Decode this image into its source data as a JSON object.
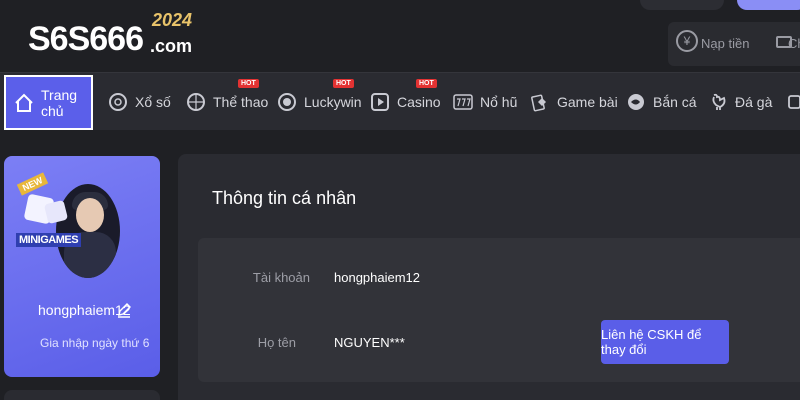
{
  "header": {
    "logo_main": "S6S666",
    "logo_domain": ".com",
    "logo_year": "2024",
    "deposit_label": "Nạp tiền",
    "transfer_label": "Chuyển"
  },
  "nav": {
    "items": [
      {
        "label": "Trang chủ",
        "icon": "home-icon",
        "active": true,
        "hot": false
      },
      {
        "label": "Xổ số",
        "icon": "lottery-ball-icon",
        "active": false,
        "hot": false
      },
      {
        "label": "Thể thao",
        "icon": "sports-ball-icon",
        "active": false,
        "hot": true
      },
      {
        "label": "Luckywin",
        "icon": "poker-chip-icon",
        "active": false,
        "hot": true
      },
      {
        "label": "Casino",
        "icon": "play-icon",
        "active": false,
        "hot": true
      },
      {
        "label": "Nổ hũ",
        "icon": "slot-777-icon",
        "active": false,
        "hot": false
      },
      {
        "label": "Game bài",
        "icon": "cards-icon",
        "active": false,
        "hot": false
      },
      {
        "label": "Bắn cá",
        "icon": "fish-icon",
        "active": false,
        "hot": false
      },
      {
        "label": "Đá gà",
        "icon": "rooster-icon",
        "active": false,
        "hot": false
      }
    ],
    "hot_label": "HOT"
  },
  "profile": {
    "username": "hongphaiem12",
    "join_text": "Gia nhập ngày thứ 6",
    "mini_new": "NEW",
    "mini_label": "MINIGAMES"
  },
  "personal_info": {
    "title": "Thông tin cá nhân",
    "account_label": "Tài khoản",
    "account_value": "hongphaiem12",
    "name_label": "Họ tên",
    "name_value": "NGUYEN***",
    "contact_button": "Liên hệ CSKH để thay đổi"
  },
  "colors": {
    "accent": "#5b5fea",
    "background": "#1f2024",
    "panel": "#2a2b31",
    "hot_badge": "#e33232"
  }
}
